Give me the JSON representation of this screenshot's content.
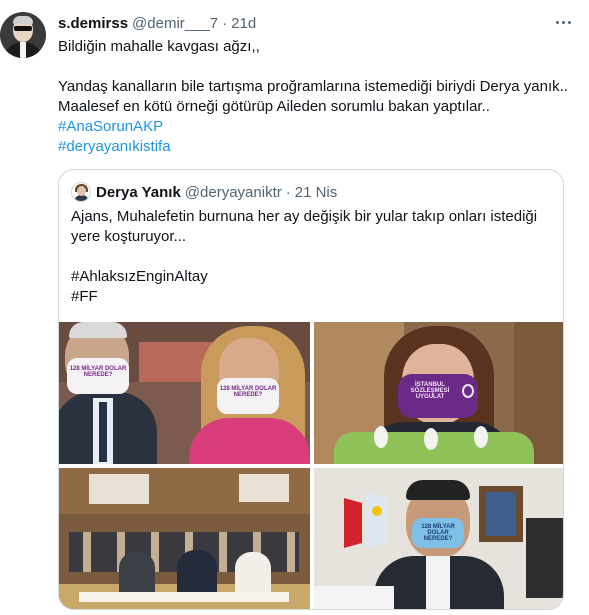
{
  "tweet": {
    "display_name": "s.demirss",
    "handle": "@demir___7",
    "separator": "·",
    "time": "21d",
    "lines": [
      "Bildiğin mahalle kavgası ağzı,,",
      "",
      "Yandaş kanalların bile tartışma proğramlarına istemediği biriydi Derya yanık..",
      "Maalesef en kötü örneği götürüp Aileden sorumlu bakan yaptılar.."
    ],
    "hashtags": [
      "#AnaSorunAKP",
      "#deryayanıkistifa"
    ]
  },
  "quoted": {
    "display_name": "Derya Yanık",
    "handle": "@deryayaniktr",
    "separator": "·",
    "time": "21 Nis",
    "lines": [
      "Ajans, Muhalefetin burnuna her ay değişik bir yular takıp onları istediği",
      "yere koşturuyor..."
    ],
    "hashtags": [
      "#AhlaksızEnginAltay",
      "#FF"
    ],
    "photo_mask_texts": {
      "photo1_left": "128 MİLYAR DOLAR NEREDE?",
      "photo1_right": "128 MİLYAR DOLAR NEREDE?",
      "photo2": "İSTANBUL SÖZLEŞMESİ UYGULAT",
      "photo4": "128 MİLYAR DOLAR NEREDE?"
    }
  },
  "icons": {
    "more": "more-dots-icon"
  },
  "colors": {
    "link": "#1b95e0",
    "muted": "#536471",
    "border": "#cfd9de",
    "text": "#0f1419"
  }
}
